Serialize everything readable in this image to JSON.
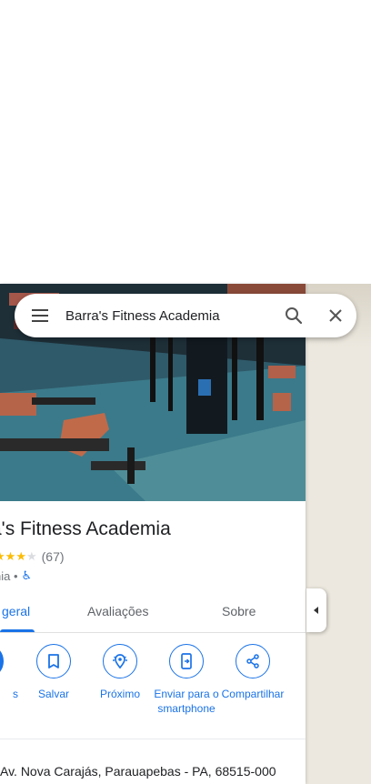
{
  "search": {
    "query": "Barra's Fitness Academia"
  },
  "place": {
    "title": "a's Fitness Academia",
    "rating_fraction": 0.6,
    "review_count": "(67)",
    "category": "nia •"
  },
  "tabs": [
    {
      "label": "geral",
      "active": true
    },
    {
      "label": "Avaliações",
      "active": false
    },
    {
      "label": "Sobre",
      "active": false
    }
  ],
  "actions": [
    {
      "label": "s",
      "icon": "directions-icon"
    },
    {
      "label": "Salvar",
      "icon": "bookmark-icon"
    },
    {
      "label": "Próximo",
      "icon": "nearby-icon"
    },
    {
      "label": "Enviar para o smartphone",
      "icon": "send-to-phone-icon"
    },
    {
      "label": "Compartilhar",
      "icon": "share-icon"
    }
  ],
  "address": "Av. Nova Carajás, Parauapebas - PA, 68515-000",
  "colors": {
    "accent": "#1a73e8",
    "star": "#fbbc04",
    "map_bg": "#ece8df"
  }
}
